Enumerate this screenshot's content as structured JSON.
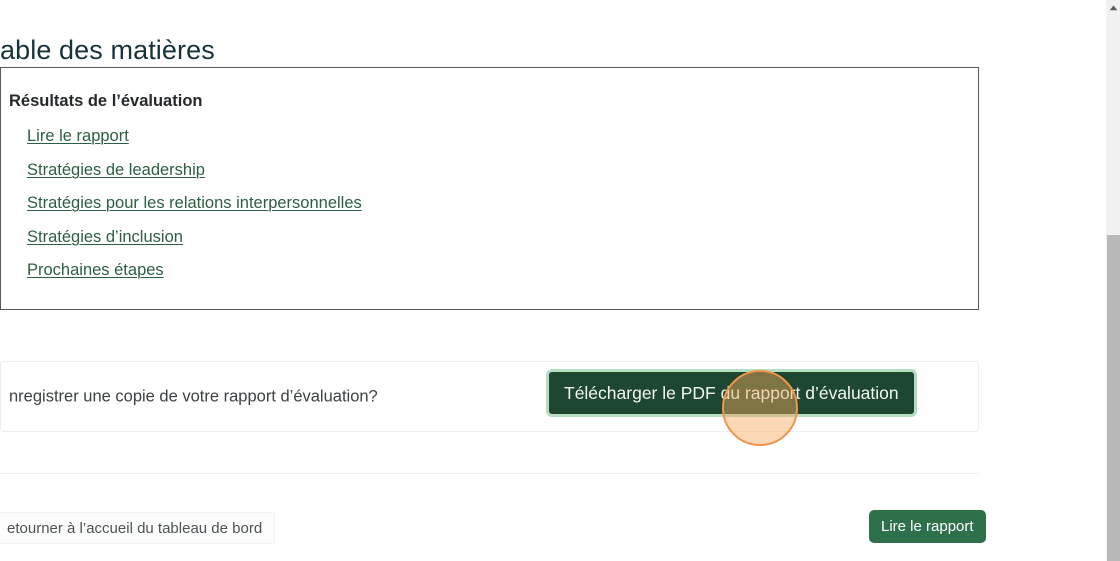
{
  "page": {
    "title": "able des matières",
    "title_full": "Table des matières"
  },
  "toc": {
    "heading": "Résultats de l’évaluation",
    "links": [
      {
        "label": "Lire le rapport"
      },
      {
        "label": "Stratégies de leadership"
      },
      {
        "label": "Stratégies pour les relations interpersonnelles"
      },
      {
        "label": "Stratégies d’inclusion"
      },
      {
        "label": "Prochaines étapes"
      }
    ]
  },
  "download": {
    "prompt": "nregistrer une copie de votre rapport d’évaluation?",
    "prompt_full": "Enregistrer une copie de votre rapport d’évaluation?",
    "button_label": "Télécharger le PDF du rapport d’évaluation"
  },
  "footer": {
    "back_label": "etourner à l’accueil du tableau de bord",
    "back_label_full": "Retourner à l’accueil du tableau de bord",
    "read_label": "Lire le rapport"
  },
  "colors": {
    "title": "#17333C",
    "link": "#2D5F43",
    "primary_button_bg": "#1D4730",
    "primary_button_ring": "#B6DDC2",
    "secondary_button_bg": "#2E7049",
    "cursor_halo_ring": "#F0954A",
    "toc_border": "#555B5E"
  },
  "scrollbar": {
    "up_arrow_icon": "caret-up-icon"
  }
}
